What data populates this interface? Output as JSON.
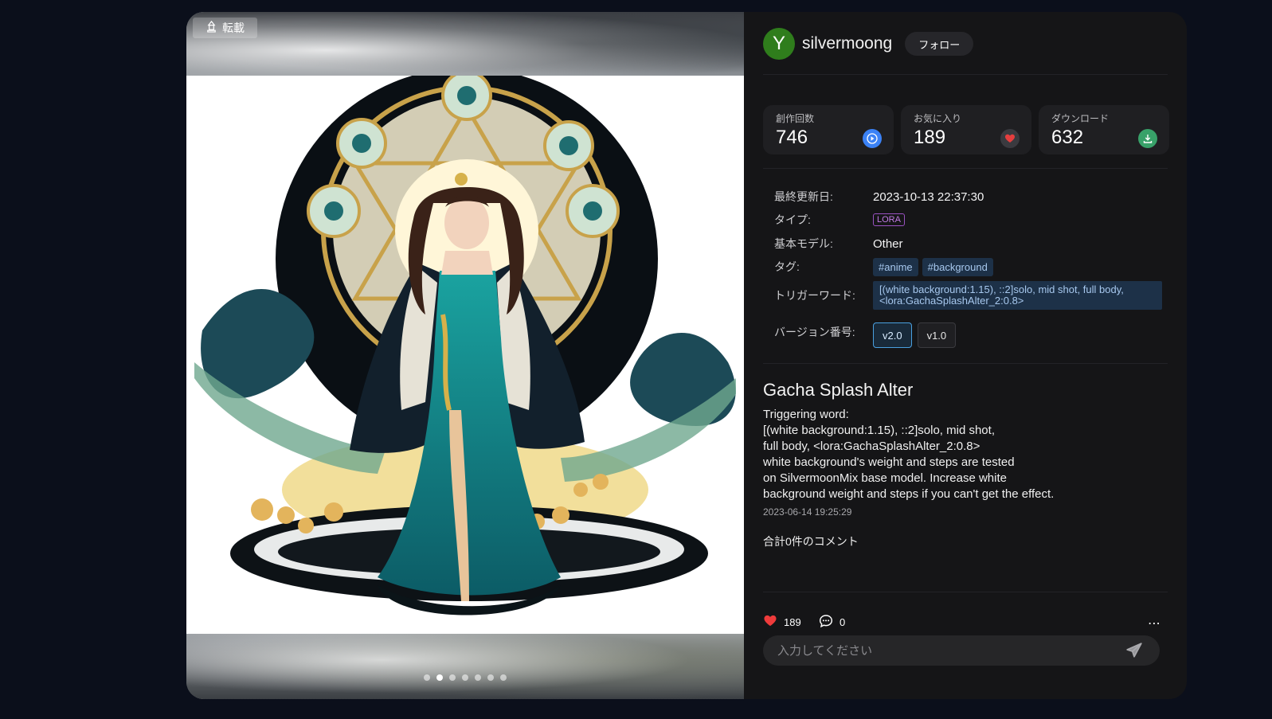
{
  "media": {
    "repost_label": "転載",
    "image_count": 7,
    "active_index": 1
  },
  "author": {
    "avatar_letter": "Y",
    "avatar_color": "#2f7d1c",
    "name": "silvermoong",
    "follow_label": "フォロー"
  },
  "stats": [
    {
      "label": "創作回数",
      "value": "746",
      "icon": "play-icon",
      "color": "#3b82f6"
    },
    {
      "label": "お気に入り",
      "value": "189",
      "icon": "heart-icon",
      "color": "#e53e3e"
    },
    {
      "label": "ダウンロード",
      "value": "632",
      "icon": "download-icon",
      "color": "#38a169"
    }
  ],
  "meta": {
    "updated_label": "最終更新日:",
    "updated_value": "2023-10-13 22:37:30",
    "type_label": "タイプ:",
    "type_value": "LORA",
    "base_model_label": "基本モデル:",
    "base_model_value": "Other",
    "tags_label": "タグ:",
    "tags": [
      "#anime",
      "#background"
    ],
    "trigger_label": "トリガーワード:",
    "trigger_value": "[(white background:1.15), ::2]solo, mid shot, full body, <lora:GachaSplashAlter_2:0.8>",
    "version_label": "バージョン番号:",
    "versions": [
      "v2.0",
      "v1.0"
    ],
    "active_version": "v2.0"
  },
  "post": {
    "title": "Gacha Splash Alter",
    "body": "Triggering word:\n[(white background:1.15), ::2]solo, mid shot,\nfull body, <lora:GachaSplashAlter_2:0.8>\nwhite background's weight and steps are tested\non SilvermoonMix base model. Increase white\nbackground weight and steps if you can't get the effect.",
    "date": "2023-06-14 19:25:29",
    "comment_count_text": "合計0件のコメント"
  },
  "actions": {
    "likes": "189",
    "comments": "0",
    "more": "⋯"
  },
  "comment_input": {
    "placeholder": "入力してください",
    "value": ""
  }
}
